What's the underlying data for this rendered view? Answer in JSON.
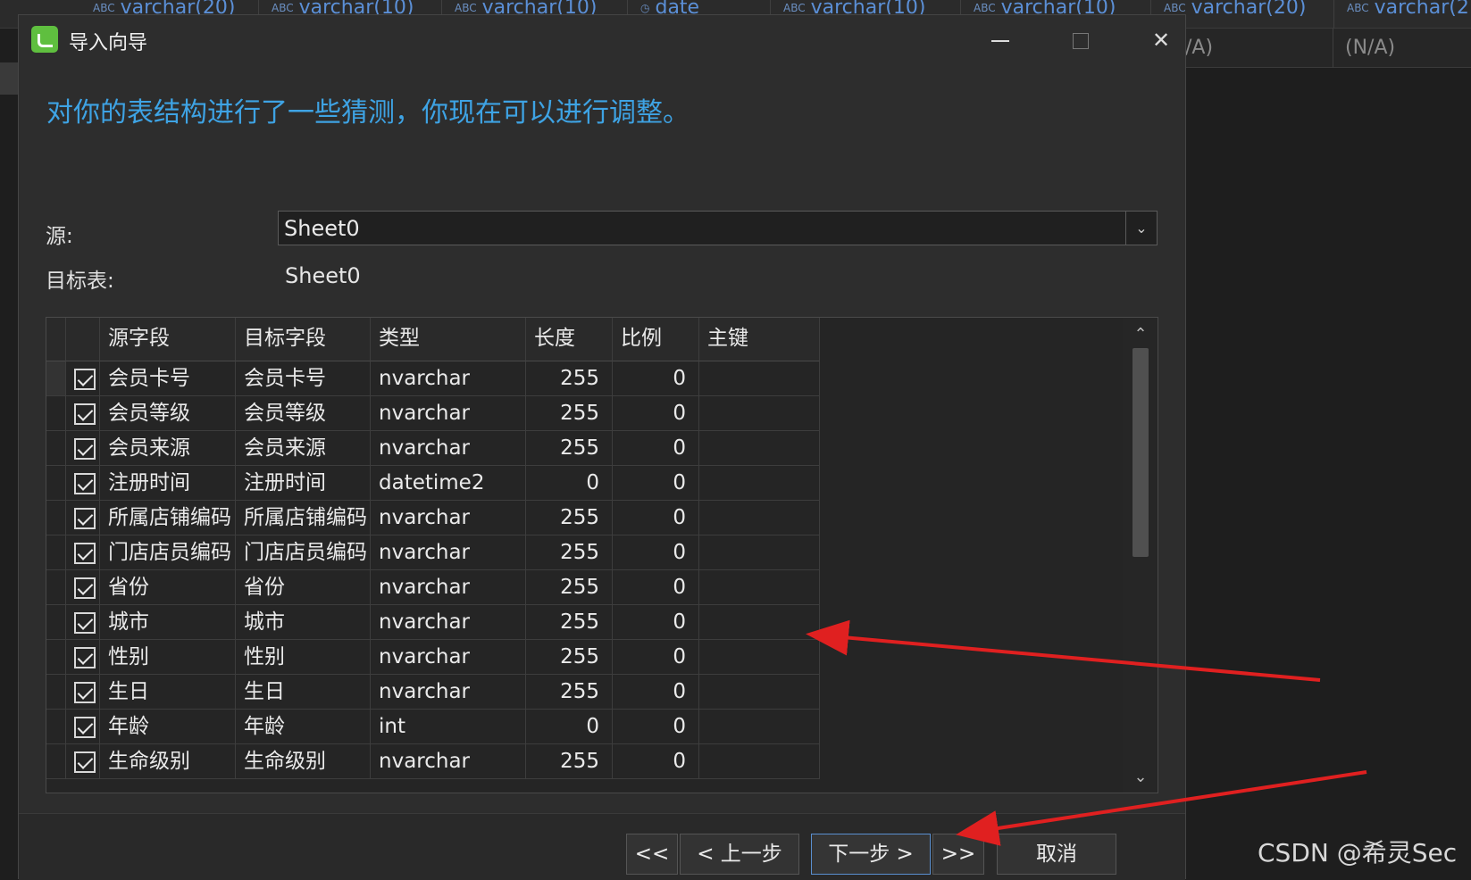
{
  "background": {
    "columns": [
      {
        "type_icon": "ABC",
        "label": "varchar(20)"
      },
      {
        "type_icon": "ABC",
        "label": "varchar(10)"
      },
      {
        "type_icon": "ABC",
        "label": "varchar(10)"
      },
      {
        "type_icon": "clock",
        "label": "date"
      },
      {
        "type_icon": "ABC",
        "label": "varchar(10)"
      },
      {
        "type_icon": "ABC",
        "label": "varchar(10)"
      },
      {
        "type_icon": "ABC",
        "label": "varchar(20)"
      },
      {
        "type_icon": "ABC",
        "label": "varchar(2"
      }
    ],
    "cells": [
      "/A)",
      "(N/A)"
    ]
  },
  "dialog": {
    "title": "导入向导",
    "heading": "对你的表结构进行了一些猜测，你现在可以进行调整。",
    "source_label": "源:",
    "source_value": "Sheet0",
    "target_label": "目标表:",
    "target_value": "Sheet0",
    "columns": [
      "源字段",
      "目标字段",
      "类型",
      "长度",
      "比例",
      "主键"
    ],
    "rows": [
      {
        "checked": true,
        "src": "会员卡号",
        "tgt": "会员卡号",
        "type": "nvarchar",
        "len": "255",
        "scale": "0",
        "pk": ""
      },
      {
        "checked": true,
        "src": "会员等级",
        "tgt": "会员等级",
        "type": "nvarchar",
        "len": "255",
        "scale": "0",
        "pk": ""
      },
      {
        "checked": true,
        "src": "会员来源",
        "tgt": "会员来源",
        "type": "nvarchar",
        "len": "255",
        "scale": "0",
        "pk": ""
      },
      {
        "checked": true,
        "src": "注册时间",
        "tgt": "注册时间",
        "type": "datetime2",
        "len": "0",
        "scale": "0",
        "pk": ""
      },
      {
        "checked": true,
        "src": "所属店铺编码",
        "tgt": "所属店铺编码",
        "type": "nvarchar",
        "len": "255",
        "scale": "0",
        "pk": ""
      },
      {
        "checked": true,
        "src": "门店店员编码",
        "tgt": "门店店员编码",
        "type": "nvarchar",
        "len": "255",
        "scale": "0",
        "pk": ""
      },
      {
        "checked": true,
        "src": "省份",
        "tgt": "省份",
        "type": "nvarchar",
        "len": "255",
        "scale": "0",
        "pk": ""
      },
      {
        "checked": true,
        "src": "城市",
        "tgt": "城市",
        "type": "nvarchar",
        "len": "255",
        "scale": "0",
        "pk": ""
      },
      {
        "checked": true,
        "src": "性别",
        "tgt": "性别",
        "type": "nvarchar",
        "len": "255",
        "scale": "0",
        "pk": ""
      },
      {
        "checked": true,
        "src": "生日",
        "tgt": "生日",
        "type": "nvarchar",
        "len": "255",
        "scale": "0",
        "pk": ""
      },
      {
        "checked": true,
        "src": "年龄",
        "tgt": "年龄",
        "type": "int",
        "len": "0",
        "scale": "0",
        "pk": ""
      },
      {
        "checked": true,
        "src": "生命级别",
        "tgt": "生命级别",
        "type": "nvarchar",
        "len": "255",
        "scale": "0",
        "pk": ""
      }
    ],
    "buttons": {
      "first": "<<",
      "prev": "< 上一步",
      "next": "下一步 >",
      "last": ">>",
      "cancel": "取消"
    }
  },
  "watermark": "CSDN @希灵Sec",
  "colors": {
    "heading": "#3ea3e4",
    "annotation_arrow": "#e02020",
    "dialog_bg": "#2d2d2d"
  }
}
